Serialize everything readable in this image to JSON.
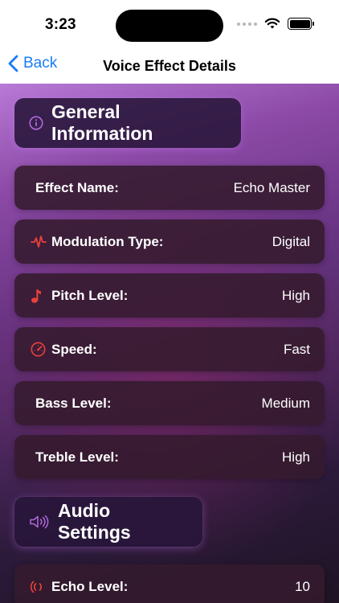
{
  "status_bar": {
    "time": "3:23"
  },
  "nav": {
    "back_label": "Back",
    "title": "Voice Effect Details"
  },
  "sections": {
    "general": {
      "title": "General Information",
      "icon": "info-circle-icon",
      "rows": [
        {
          "label": "Effect Name:",
          "value": "Echo Master"
        },
        {
          "label": "Modulation Type:",
          "value": "Digital",
          "icon": "waveform-icon"
        },
        {
          "label": "Pitch Level:",
          "value": "High",
          "icon": "music-note-icon"
        },
        {
          "label": "Speed:",
          "value": "Fast",
          "icon": "speedometer-icon"
        },
        {
          "label": "Bass Level:",
          "value": "Medium"
        },
        {
          "label": "Treble Level:",
          "value": "High"
        }
      ]
    },
    "audio": {
      "title": "Audio Settings",
      "icon": "speaker-wave-icon",
      "rows": [
        {
          "label": "Echo Level:",
          "value": "10",
          "icon": "broadcast-icon"
        }
      ]
    }
  },
  "colors": {
    "accent": "#1a7cf5",
    "icon_red": "#e8413c",
    "icon_purple": "#b06ad8"
  }
}
